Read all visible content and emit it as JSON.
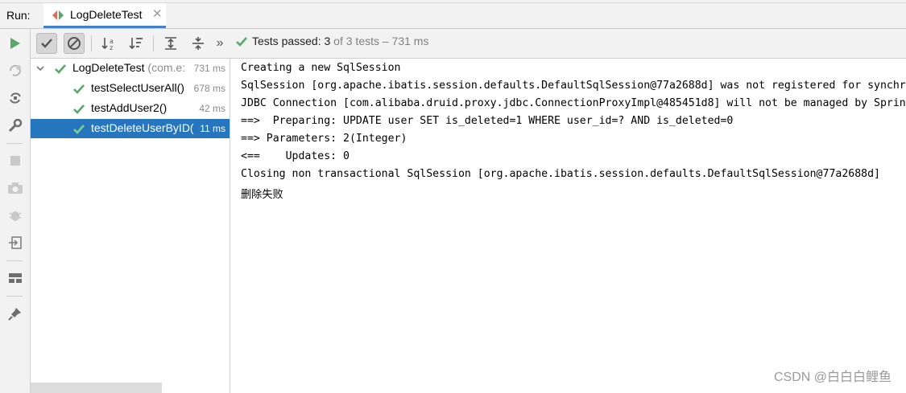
{
  "run_label": "Run:",
  "tab": {
    "title": "LogDeleteTest",
    "close_glyph": "✕"
  },
  "toolbar": {
    "status_prefix": "Tests passed: ",
    "status_count": "3",
    "status_suffix": " of 3 tests – 731 ms",
    "more_glyph": "»"
  },
  "tree": {
    "root": {
      "name": "LogDeleteTest",
      "package": " (com.e:",
      "time": "731 ms"
    },
    "items": [
      {
        "name": "testSelectUserAll()",
        "time": "678 ms"
      },
      {
        "name": "testAddUser2()",
        "time": "42 ms"
      },
      {
        "name": "testDeleteUserByID(",
        "time": "11 ms"
      }
    ]
  },
  "console": {
    "lines": [
      "Creating a new SqlSession",
      "SqlSession [org.apache.ibatis.session.defaults.DefaultSqlSession@77a2688d] was not registered for synchr",
      "JDBC Connection [com.alibaba.druid.proxy.jdbc.ConnectionProxyImpl@485451d8] will not be managed by Sprin",
      "==>  Preparing: UPDATE user SET is_deleted=1 WHERE user_id=? AND is_deleted=0",
      "==> Parameters: 2(Integer)",
      "<==    Updates: 0",
      "Closing non transactional SqlSession [org.apache.ibatis.session.defaults.DefaultSqlSession@77a2688d]",
      "删除失败"
    ]
  },
  "watermark": "CSDN @白白白鲤鱼",
  "colors": {
    "pass_green": "#59a869",
    "selection_blue": "#2675bf",
    "run_green": "#59a869"
  }
}
